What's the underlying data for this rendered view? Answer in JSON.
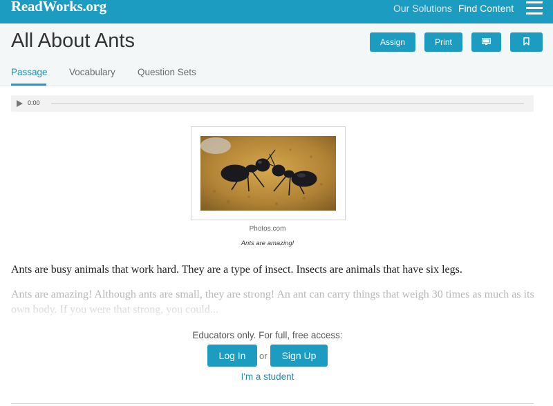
{
  "app": {
    "logo_text": "ReadWorks.org"
  },
  "nav": {
    "links": [
      {
        "label": "Our Solutions"
      },
      {
        "label": "Find Content"
      }
    ],
    "menu_icon": "hamburger-menu-icon"
  },
  "header": {
    "title": "All About Ants",
    "buttons": {
      "assign": "Assign",
      "print": "Print",
      "present_icon": "monitor-icon",
      "bookmark_icon": "bookmark-icon"
    },
    "tabs": [
      {
        "label": "Passage",
        "active": true
      },
      {
        "label": "Vocabulary",
        "active": false
      },
      {
        "label": "Question Sets",
        "active": false
      }
    ]
  },
  "audio": {
    "time": "0:00",
    "play_icon": "play-icon"
  },
  "figure": {
    "credit": "Photos.com",
    "caption": "Ants are amazing!"
  },
  "passage": {
    "paragraph1": "Ants are busy animals that work hard. They are a type of insect. Insects are animals that have six legs.",
    "paragraph2": "Ants are amazing! Although ants are small, they are strong! An ant can carry things that weigh 30 times as much as its own body. If you were that strong, you could..."
  },
  "access": {
    "message": "Educators only. For full, free access:",
    "login_label": "Log In",
    "or_text": "or",
    "signup_label": "Sign Up",
    "student_link": "I'm a student"
  },
  "colors": {
    "brand": "#1c9cc1",
    "header_bg": "#f4f7f8"
  }
}
